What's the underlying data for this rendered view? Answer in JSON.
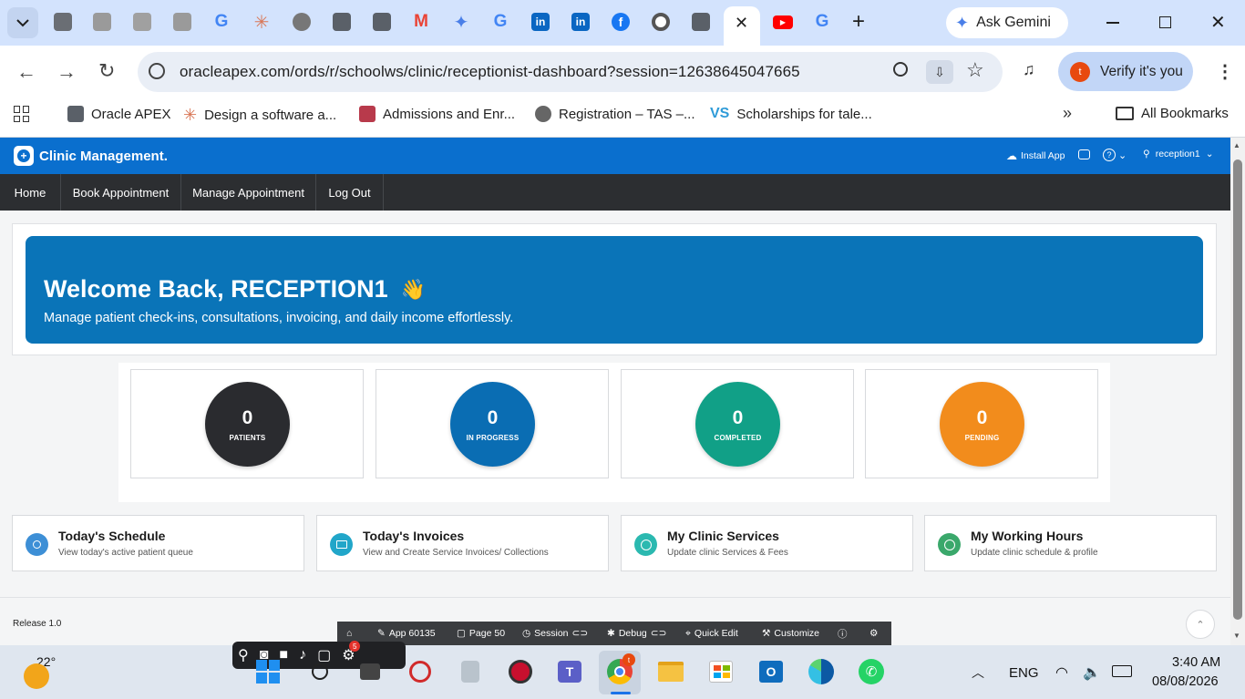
{
  "browser": {
    "gemini_label": "Ask Gemini",
    "url": "oracleapex.com/ords/r/schoolws/clinic/receptionist-dashboard?session=12638645047665",
    "verify_label": "Verify it's you",
    "profile_initial": "t",
    "bookmarks": [
      {
        "label": "Oracle APEX"
      },
      {
        "label": "Design a software a..."
      },
      {
        "label": "Admissions and Enr..."
      },
      {
        "label": "Registration – TAS –..."
      },
      {
        "label": "Scholarships for tale..."
      }
    ],
    "all_bookmarks": "All Bookmarks"
  },
  "app": {
    "title": "Clinic Management.",
    "install_app": "Install App",
    "user": "reception1",
    "nav": [
      "Home",
      "Book Appointment",
      "Manage Appointment",
      "Log Out"
    ],
    "hero": {
      "title": "Welcome Back, RECEPTION1",
      "emoji": "👋",
      "subtitle": "Manage patient check-ins, consultations, invoicing, and daily income effortlessly."
    },
    "stats": [
      {
        "value": "0",
        "label": "PATIENTS",
        "color": "#2a2b2f"
      },
      {
        "value": "0",
        "label": "IN PROGRESS",
        "color": "#0a6db3"
      },
      {
        "value": "0",
        "label": "COMPLETED",
        "color": "#11a087"
      },
      {
        "value": "0",
        "label": "PENDING",
        "color": "#f28c1c"
      }
    ],
    "cards": [
      {
        "title": "Today's Schedule",
        "subtitle": "View today's active patient queue",
        "color": "#3d8fd6"
      },
      {
        "title": "Today's Invoices",
        "subtitle": "View and Create Service Invoices/ Collections",
        "color": "#21a6c9"
      },
      {
        "title": "My Clinic Services",
        "subtitle": "Update clinic Services & Fees",
        "color": "#2bb9b0"
      },
      {
        "title": "My Working Hours",
        "subtitle": "Update clinic schedule & profile",
        "color": "#3aa86b"
      }
    ],
    "release": "Release 1.0",
    "devbar": {
      "app": "App 60135",
      "page": "Page 50",
      "session": "Session",
      "debug": "Debug",
      "quick_edit": "Quick Edit",
      "customize": "Customize"
    }
  },
  "taskbar": {
    "weather": "22°",
    "lang": "ENG",
    "time": "3:40 AM",
    "date": "08/08/2026",
    "notif_count": "5",
    "chrome_badge": "t"
  }
}
